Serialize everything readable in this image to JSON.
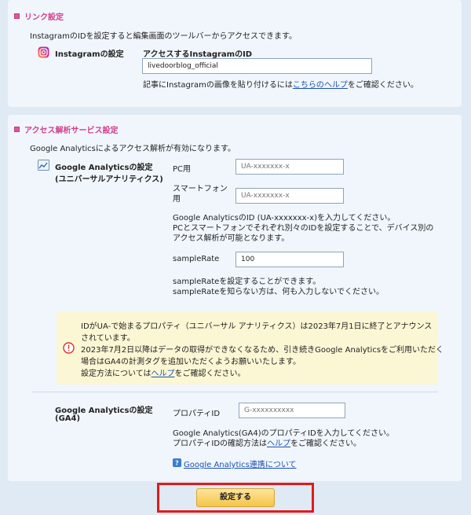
{
  "link_section": {
    "title": "リンク設定",
    "description": "InstagramのIDを設定すると編集画面のツールバーからアクセスできます。",
    "instagram_label": "Instagramの設定",
    "id_header": "アクセスするInstagramのID",
    "id_value": "livedoorblog_official",
    "help_prefix": "記事にInstagramの画像を貼り付けるには",
    "help_link": "こちらのヘルプ",
    "help_suffix": "をご確認ください。"
  },
  "analytics_section": {
    "title": "アクセス解析サービス設定",
    "description": "Google Analyticsによるアクセス解析が有効になります。",
    "ua_label_line1": "Google Analyticsの設定",
    "ua_label_line2": "(ユニバーサルアナリティクス)",
    "pc_label": "PC用",
    "pc_placeholder": "UA-xxxxxxx-x",
    "sp_label_line1": "スマートフォン",
    "sp_label_line2": "用",
    "sp_placeholder": "UA-xxxxxxx-x",
    "ua_help_line1": "Google AnalyticsのID (UA-xxxxxxx-x)を入力してください。",
    "ua_help_line2": "PCとスマートフォンでそれぞれ別々のIDを設定することで、デバイス別の",
    "ua_help_line3": "アクセス解析が可能となります。",
    "samplerate_label": "sampleRate",
    "samplerate_value": "100",
    "samplerate_help_line1": "sampleRateを設定することができます。",
    "samplerate_help_line2": "sampleRateを知らない方は、何も入力しないでください。",
    "notice_line1": "IDがUA-で始まるプロパティ（ユニバーサル アナリティクス）は2023年7月1日に終了とアナウンス",
    "notice_line2": "されています。",
    "notice_line3": "2023年7月2日以降はデータの取得ができなくなるため、引き続きGoogle Analyticsをご利用いただく",
    "notice_line4": "場合はGA4の計測タグを追加いただくようお願いいたします。",
    "notice_line5_prefix": "設定方法については",
    "notice_line5_link": "ヘルプ",
    "notice_line5_suffix": "をご確認ください。",
    "ga4_label_line1": "Google Analyticsの設定",
    "ga4_label_line2": "(GA4)",
    "property_label": "プロパティID",
    "property_placeholder": "G-xxxxxxxxxx",
    "ga4_help_line1": "Google Analytics(GA4)のプロパティIDを入力してください。",
    "ga4_help_line2_prefix": "プロパティIDの確認方法は",
    "ga4_help_line2_link": "ヘルプ",
    "ga4_help_line2_suffix": "をご確認ください。",
    "integration_link": "Google Analytics連携について"
  },
  "save_button": "設定する",
  "colors": {
    "accent_pink": "#d23c8c",
    "link_blue": "#1a4fb8",
    "highlight_red": "#e01b1b",
    "button_yellow": "#f3c54a"
  }
}
